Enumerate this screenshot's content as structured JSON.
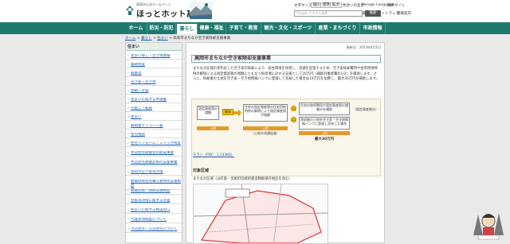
{
  "header": {
    "site_sub": "高岡市公式ホームページ",
    "site_name": "ほっとホット高岡",
    "utilities": {
      "text_size_label": "文字サイズ",
      "size_small": "縮小",
      "size_standard": "標準",
      "size_large": "拡大",
      "color_label": "色合いの変更",
      "foreign_language": "Foreign Language",
      "mobile_site": "携帯サイト",
      "search_method": "検索方法",
      "sitemap": "サイトマップ",
      "org_list": "組織案内"
    },
    "search": {
      "placeholder": "Google カスタム検索",
      "button": "検索"
    }
  },
  "nav": {
    "items": [
      {
        "label": "ホーム"
      },
      {
        "label": "防災・防犯"
      },
      {
        "label": "暮らし"
      },
      {
        "label": "健康・福祉"
      },
      {
        "label": "子育て・教育"
      },
      {
        "label": "観光・文化・スポーツ"
      },
      {
        "label": "産業・まちづくり"
      },
      {
        "label": "市政情報"
      }
    ]
  },
  "breadcrumb": {
    "home": "ホーム",
    "sep": " > ",
    "level1": "暮らし",
    "level2": "住まい",
    "current": "高岡市まちなか空き家除却支援事業"
  },
  "sidebar": {
    "title": "住まい",
    "items": [
      "住まい探し・空き地情報",
      "補助制度",
      "耐震化",
      "空き家・空き地",
      "景観・計画",
      "住まいに関する申請書",
      "引越し・転居",
      "住まい",
      "補助金メニュー一覧",
      "住宅相談",
      "住宅リフォーム・ストック制度",
      "木造住宅耐震化の助成事業",
      "木造住宅耐震診断の支援事業",
      "高岡市空き家等対策",
      "耐震改修住宅購入者特別支援制度",
      "耐震診断・改修支援制度",
      "空家等対策に関する計画",
      "住まいに関する相談窓口",
      "代理受領制度について",
      "市営住宅・公営住宅について"
    ]
  },
  "main": {
    "updated": "更新日：2023年4月1日",
    "title": "高岡市まちなか空き家除却支援事業",
    "body": "まちなか区域の老朽化した空き家の除却により、居住環境を改善し、流通を促進するため、空き家除却費用や住宅用地特例の解除による固定資産税の増額にともなう負担増に対する支援として20万円（補助対象経費の1/2）を補助します。さらに、除却後の土地を空き家・空き地情報バンクに登録して売却した場合は10万円を加算し、最大30万円を補助します。",
    "diagram": {
      "box_left_1": "固定資産税の増額",
      "box_left_2": "解体",
      "box_mid_1": "住宅の固定資産税の住宅用地特例の解除により固定資産税が増額",
      "box_mid_2": "（土地の流通促進）",
      "box_right_1": "住宅の除却費用や固定資産税の増額分を補助",
      "box_right_2": "除却後の土地を空き家・空き地情報バンクに登録し売却した場合",
      "coin_1": "20",
      "coin_2": "10",
      "bar_1": "土地",
      "bar_2": "土地",
      "bar_3": "土地",
      "side_note": "（固定資産税分）",
      "total": "最大30万円"
    },
    "pdf_link": "チラシ（PDF：1,133KB）",
    "section_title": "対象区域",
    "area_title": "まちなか区域（山町筋・金屋町伝統的建造物群保存地区を含む）"
  },
  "colors": {
    "nav_bg": "#1e7a6e",
    "link": "#1a5fb4",
    "diagram_bg": "#fbf6ea"
  }
}
